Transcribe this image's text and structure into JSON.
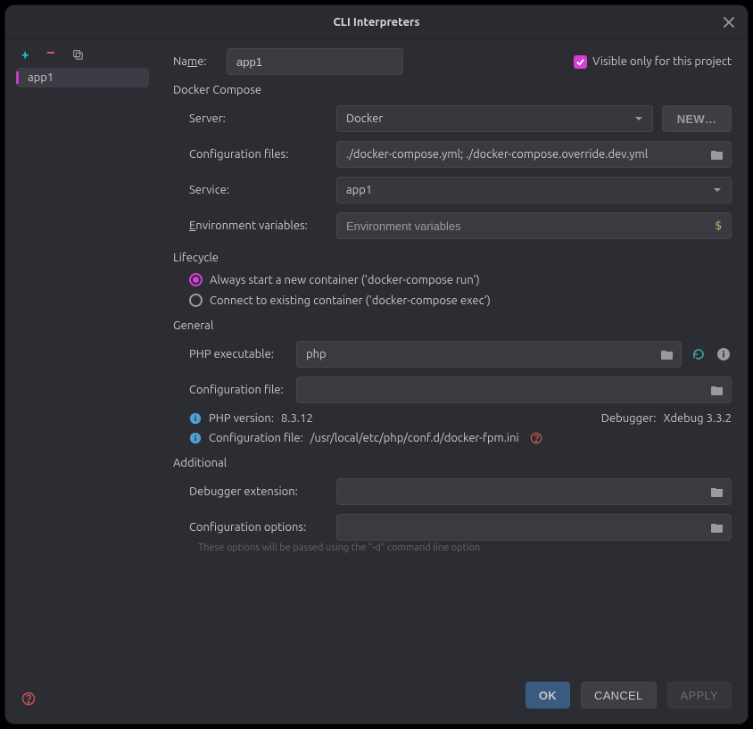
{
  "title": "CLI Interpreters",
  "sidebar": {
    "items": [
      {
        "label": "app1"
      }
    ]
  },
  "name": {
    "label": "Name:",
    "label_underline_char": "m",
    "value": "app1"
  },
  "visible_only": {
    "label": "Visible only for this project",
    "checked": true
  },
  "docker_compose": {
    "section": "Docker Compose",
    "server": {
      "label": "Server:",
      "value": "Docker",
      "new_btn": "NEW…"
    },
    "config_files": {
      "label": "Configuration files:",
      "value": "./docker-compose.yml; ./docker-compose.override.dev.yml"
    },
    "service": {
      "label": "Service:",
      "value": "app1"
    },
    "env": {
      "label": "Environment variables:",
      "label_underline_char": "E",
      "placeholder": "Environment variables"
    }
  },
  "lifecycle": {
    "section": "Lifecycle",
    "opt1": "Always start a new container ('docker-compose run')",
    "opt2": "Connect to existing container ('docker-compose exec')",
    "selected": 1
  },
  "general": {
    "section": "General",
    "php_exe": {
      "label": "PHP executable:",
      "value": "php"
    },
    "config_file": {
      "label": "Configuration file:",
      "value": ""
    },
    "php_version": {
      "label": "PHP version:",
      "value": "8.3.12"
    },
    "debugger": {
      "label": "Debugger:",
      "value": "Xdebug 3.3.2"
    },
    "ini": {
      "label": "Configuration file:",
      "value": "/usr/local/etc/php/conf.d/docker-fpm.ini"
    }
  },
  "additional": {
    "section": "Additional",
    "dbg_ext": {
      "label": "Debugger extension:",
      "value": ""
    },
    "cfg_opts": {
      "label": "Configuration options:",
      "value": ""
    },
    "hint": "These options will be passed using the \"-d\" command line option"
  },
  "buttons": {
    "ok": "OK",
    "cancel": "CANCEL",
    "apply": "APPLY"
  }
}
